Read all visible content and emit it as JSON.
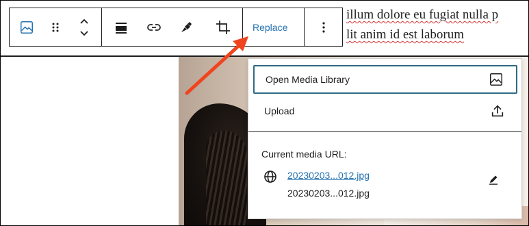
{
  "background_text": {
    "line1": "illum dolore eu fugiat nulla p",
    "line2": "lit anim id est laborum"
  },
  "toolbar": {
    "items": [
      "image-icon",
      "drag-handle-icon",
      "move-updown-icon",
      "align-icon",
      "link-icon",
      "duotone-icon",
      "crop-icon",
      "options-icon"
    ],
    "replace_label": "Replace"
  },
  "popover": {
    "open_media_library": "Open Media Library",
    "upload": "Upload",
    "current_url_label": "Current media URL:",
    "url_link": "20230203...012.jpg",
    "url_text": "20230203...012.jpg"
  },
  "colors": {
    "accent": "#2271b1",
    "focus_border": "#2e6b82",
    "arrow": "#f0441f"
  }
}
